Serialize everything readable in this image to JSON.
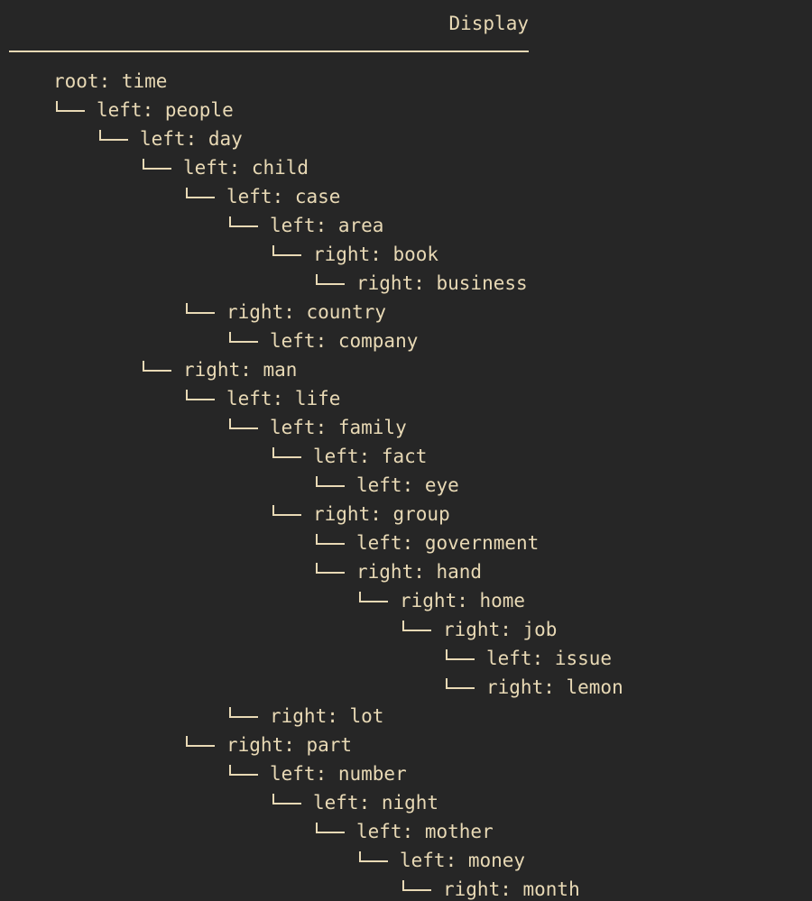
{
  "header": {
    "title": "Display"
  },
  "tree": [
    {
      "depth": 0,
      "side": "root",
      "value": "time"
    },
    {
      "depth": 1,
      "side": "left",
      "value": "people"
    },
    {
      "depth": 2,
      "side": "left",
      "value": "day"
    },
    {
      "depth": 3,
      "side": "left",
      "value": "child"
    },
    {
      "depth": 4,
      "side": "left",
      "value": "case"
    },
    {
      "depth": 5,
      "side": "left",
      "value": "area"
    },
    {
      "depth": 6,
      "side": "right",
      "value": "book"
    },
    {
      "depth": 7,
      "side": "right",
      "value": "business"
    },
    {
      "depth": 4,
      "side": "right",
      "value": "country"
    },
    {
      "depth": 5,
      "side": "left",
      "value": "company"
    },
    {
      "depth": 3,
      "side": "right",
      "value": "man"
    },
    {
      "depth": 4,
      "side": "left",
      "value": "life"
    },
    {
      "depth": 5,
      "side": "left",
      "value": "family"
    },
    {
      "depth": 6,
      "side": "left",
      "value": "fact"
    },
    {
      "depth": 7,
      "side": "left",
      "value": "eye"
    },
    {
      "depth": 6,
      "side": "right",
      "value": "group"
    },
    {
      "depth": 7,
      "side": "left",
      "value": "government"
    },
    {
      "depth": 7,
      "side": "right",
      "value": "hand"
    },
    {
      "depth": 8,
      "side": "right",
      "value": "home"
    },
    {
      "depth": 9,
      "side": "right",
      "value": "job"
    },
    {
      "depth": 10,
      "side": "left",
      "value": "issue"
    },
    {
      "depth": 10,
      "side": "right",
      "value": "lemon"
    },
    {
      "depth": 5,
      "side": "right",
      "value": "lot"
    },
    {
      "depth": 4,
      "side": "right",
      "value": "part"
    },
    {
      "depth": 5,
      "side": "left",
      "value": "number"
    },
    {
      "depth": 6,
      "side": "left",
      "value": "night"
    },
    {
      "depth": 7,
      "side": "left",
      "value": "mother"
    },
    {
      "depth": 8,
      "side": "left",
      "value": "money"
    },
    {
      "depth": 9,
      "side": "right",
      "value": "month"
    }
  ]
}
